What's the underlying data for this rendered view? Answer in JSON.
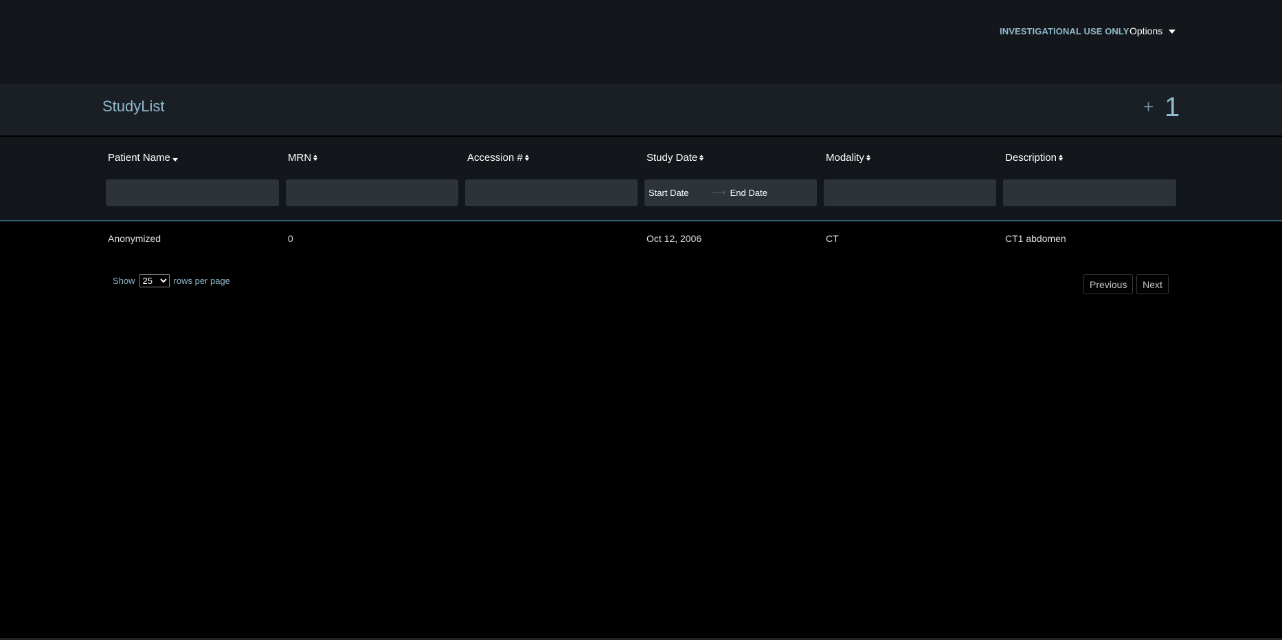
{
  "header": {
    "investigational_label": "INVESTIGATIONAL USE ONLY",
    "options_label": "Options"
  },
  "studylist": {
    "title": "StudyList",
    "plus": "+",
    "count": "1"
  },
  "columns": [
    {
      "label": "Patient Name",
      "sort": "desc"
    },
    {
      "label": "MRN",
      "sort": "both"
    },
    {
      "label": "Accession #",
      "sort": "both"
    },
    {
      "label": "Study Date",
      "sort": "both"
    },
    {
      "label": "Modality",
      "sort": "both"
    },
    {
      "label": "Description",
      "sort": "both"
    }
  ],
  "filters": {
    "patient_name": "",
    "mrn": "",
    "accession": "",
    "start_date_placeholder": "Start Date",
    "end_date_placeholder": "End Date",
    "modality": "",
    "description": ""
  },
  "rows": [
    {
      "patient_name": "Anonymized",
      "mrn": "0",
      "accession": "",
      "study_date": "Oct 12, 2006",
      "modality": "CT",
      "description": "CT1 abdomen"
    }
  ],
  "pagination": {
    "show_label": "Show",
    "rows_per_page_value": "25",
    "rows_per_page_options": [
      "25"
    ],
    "rows_per_page_label": "rows per page",
    "previous_label": "Previous",
    "next_label": "Next"
  },
  "colors": {
    "accent": "#91b9cd",
    "header_bg": "#13171c",
    "bar_bg": "#1a1f25",
    "input_bg": "#2c3339",
    "divider": "#2c6479"
  }
}
